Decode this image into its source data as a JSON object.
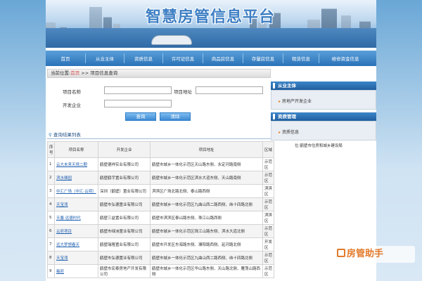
{
  "site_title": "智慧房管信息平台",
  "nav": [
    "首页",
    "从业主体",
    "资质信息",
    "许可证信息",
    "商品房信息",
    "存量房信息",
    "租赁信息",
    "维修资金信息"
  ],
  "breadcrumb": {
    "prefix": "当前位置:",
    "home": "首页",
    "sep": " >> ",
    "current": "项目信息查询"
  },
  "search": {
    "name_label": "项目名称",
    "addr_label": "项目地址",
    "dev_label": "开发企业",
    "name_value": "",
    "addr_value": "",
    "dev_value": "",
    "query_btn": "查询",
    "clear_btn": "清除"
  },
  "results": {
    "title": "查询结果列表",
    "icon": "search-icon"
  },
  "table": {
    "headers": [
      "序号",
      "项目名称",
      "开发企业",
      "项目地址",
      "区域"
    ],
    "rows": [
      [
        "1",
        "云大未来天境二期",
        "鹤壁德祥实业有限公司",
        "鹤壁市城乡一体化示范区天山路东侧、永定河路南侧",
        "示范区"
      ],
      [
        "2",
        "淇水雅园",
        "鹤壁鹤宇置业有限公司",
        "鹤壁市城乡一体化示范区淇水大道东侧、天山路南侧",
        "示范区"
      ],
      [
        "3",
        "中汇广场（中汇·云玥）",
        "深圳（鹤壁）置业有限公司",
        "淇滨区广场北路北侧、泰山路西侧",
        "淇滨区"
      ],
      [
        "4",
        "天宝湾",
        "鹤壁市弘德置业有限公司",
        "鹤壁市城乡一体化示范区九曲山西二路西侧、纬十四路北侧",
        "示范区"
      ],
      [
        "5",
        "天馨·远德时代",
        "鹤壁三益置业有限公司",
        "鹤壁市淇滨区泰山路东侧、珠江山路西侧",
        "淇滨区"
      ],
      [
        "6",
        "云府项目",
        "鹤壁市绿洲置业有限公司",
        "鹤壁市城乡一体化示范区珠江山路东侧、淇水大道北侧",
        "示范区"
      ],
      [
        "7",
        "远大梦想春天",
        "鹤壁瑞隆置业有限公司",
        "鹤壁市开发区东海路东侧、濮阳路西侧、延河路北侧",
        "开发区"
      ],
      [
        "8",
        "天宝湾",
        "鹤壁市弘德置业有限公司",
        "鹤壁市城乡一体化示范区九曲山西二路西侧、纬十四路北侧",
        "示范区"
      ],
      [
        "9",
        "雍府",
        "鹤壁市宏泰房地产开发有限公司",
        "鹤壁市城乡一体化示范区华山路东侧、天山路北侧、雁荡山路西侧",
        "示范区"
      ]
    ]
  },
  "sidebar": {
    "section1": {
      "title": "从业主体",
      "item": "房地产开发企业"
    },
    "section2": {
      "title": "资质管理",
      "item": "资质信息"
    },
    "footer_text": "位:鹤壁市住房和城乡建设局"
  },
  "watermark": "房管助手",
  "colors": {
    "nav": "#2a72b8",
    "title": "#3e7fc4",
    "link": "#1f5faf",
    "watermark": "#e27a2b"
  }
}
